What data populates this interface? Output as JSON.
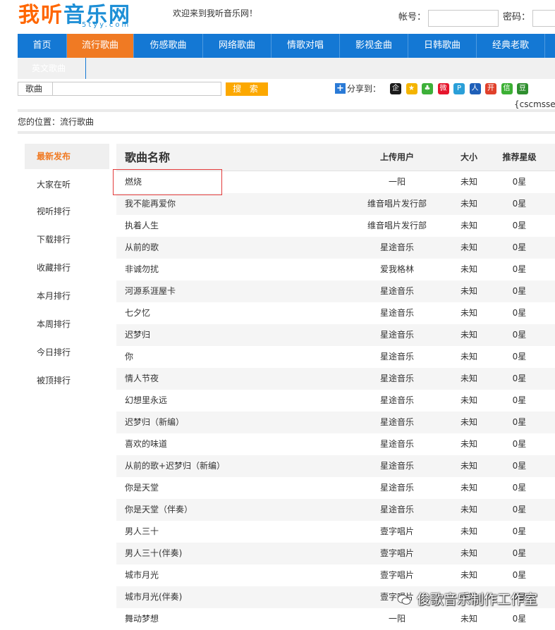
{
  "header": {
    "logo_cn_1": "我",
    "logo_cn_2": "听",
    "logo_cn_3": "音乐网",
    "logo_en": "5tyy.com",
    "welcome": "欢迎来到我听音乐网！",
    "account_label": "帐号：",
    "password_label": "密码："
  },
  "nav": {
    "items": [
      {
        "label": "首页"
      },
      {
        "label": "流行歌曲"
      },
      {
        "label": "伤感歌曲"
      },
      {
        "label": "网络歌曲"
      },
      {
        "label": "情歌对唱"
      },
      {
        "label": "影视金曲"
      },
      {
        "label": "日韩歌曲"
      },
      {
        "label": "经典老歌"
      }
    ],
    "active_index": 1,
    "sub_item": "英文歌曲"
  },
  "search": {
    "type_label": "歌曲",
    "button_label": "搜 索"
  },
  "share": {
    "label": "分享到：",
    "icons": [
      {
        "name": "qq-icon",
        "glyph": "企",
        "color": "#1a1a1a"
      },
      {
        "name": "qzone-icon",
        "glyph": "★",
        "color": "#f4b400"
      },
      {
        "name": "pengyou-icon",
        "glyph": "♣",
        "color": "#3db039"
      },
      {
        "name": "weibo-icon",
        "glyph": "微",
        "color": "#e6162d"
      },
      {
        "name": "tqq-icon",
        "glyph": "P",
        "color": "#2a9fd8"
      },
      {
        "name": "renren-icon",
        "glyph": "人",
        "color": "#1f5fb8"
      },
      {
        "name": "kaixin-icon",
        "glyph": "开",
        "color": "#e0402b"
      },
      {
        "name": "wechat-icon",
        "glyph": "信",
        "color": "#3cb034"
      },
      {
        "name": "douban-icon",
        "glyph": "豆",
        "color": "#2f8f2f"
      }
    ]
  },
  "cms_tag": "{cscmsself",
  "location": "您的位置：流行歌曲",
  "sidebar": {
    "items": [
      {
        "label": "最新发布"
      },
      {
        "label": "大家在听"
      },
      {
        "label": "视听排行"
      },
      {
        "label": "下载排行"
      },
      {
        "label": "收藏排行"
      },
      {
        "label": "本月排行"
      },
      {
        "label": "本周排行"
      },
      {
        "label": "今日排行"
      },
      {
        "label": "被顶排行"
      }
    ],
    "active_index": 0
  },
  "table": {
    "headers": {
      "name": "歌曲名称",
      "user": "上传用户",
      "size": "大小",
      "stars": "推荐星级"
    },
    "rows": [
      {
        "name": "燃烧",
        "user": "一阳",
        "size": "未知",
        "stars": "0星"
      },
      {
        "name": "我不能再爱你",
        "user": "维音唱片发行部",
        "size": "未知",
        "stars": "0星"
      },
      {
        "name": "执着人生",
        "user": "维音唱片发行部",
        "size": "未知",
        "stars": "0星"
      },
      {
        "name": "从前的歌",
        "user": "星途音乐",
        "size": "未知",
        "stars": "0星"
      },
      {
        "name": "非诚勿扰",
        "user": "爱我格林",
        "size": "未知",
        "stars": "0星"
      },
      {
        "name": "河源系涯屋卡",
        "user": "星途音乐",
        "size": "未知",
        "stars": "0星"
      },
      {
        "name": "七夕忆",
        "user": "星途音乐",
        "size": "未知",
        "stars": "0星"
      },
      {
        "name": "迟梦归",
        "user": "星途音乐",
        "size": "未知",
        "stars": "0星"
      },
      {
        "name": "你",
        "user": "星途音乐",
        "size": "未知",
        "stars": "0星"
      },
      {
        "name": "情人节夜",
        "user": "星途音乐",
        "size": "未知",
        "stars": "0星"
      },
      {
        "name": "幻想里永远",
        "user": "星途音乐",
        "size": "未知",
        "stars": "0星"
      },
      {
        "name": "迟梦归（新编）",
        "user": "星途音乐",
        "size": "未知",
        "stars": "0星"
      },
      {
        "name": "喜欢的味道",
        "user": "星途音乐",
        "size": "未知",
        "stars": "0星"
      },
      {
        "name": "从前的歌+迟梦归（新编）",
        "user": "星途音乐",
        "size": "未知",
        "stars": "0星"
      },
      {
        "name": "你是天堂",
        "user": "星途音乐",
        "size": "未知",
        "stars": "0星"
      },
      {
        "name": "你是天堂（伴奏）",
        "user": "星途音乐",
        "size": "未知",
        "stars": "0星"
      },
      {
        "name": "男人三十",
        "user": "壹字唱片",
        "size": "未知",
        "stars": "0星"
      },
      {
        "name": "男人三十(伴奏)",
        "user": "壹字唱片",
        "size": "未知",
        "stars": "0星"
      },
      {
        "name": "城市月光",
        "user": "壹字唱片",
        "size": "未知",
        "stars": "0星"
      },
      {
        "name": "城市月光(伴奏)",
        "user": "壹字唱片",
        "size": "未知",
        "stars": "0星"
      },
      {
        "name": "舞动梦想",
        "user": "一阳",
        "size": "未知",
        "stars": "0星"
      }
    ]
  },
  "watermark": "俊歌音乐制作工作室",
  "colors": {
    "nav_bg": "#1478d4",
    "nav_active": "#f07a23",
    "search_button": "#fca800",
    "highlight_border": "#e23b3b"
  }
}
